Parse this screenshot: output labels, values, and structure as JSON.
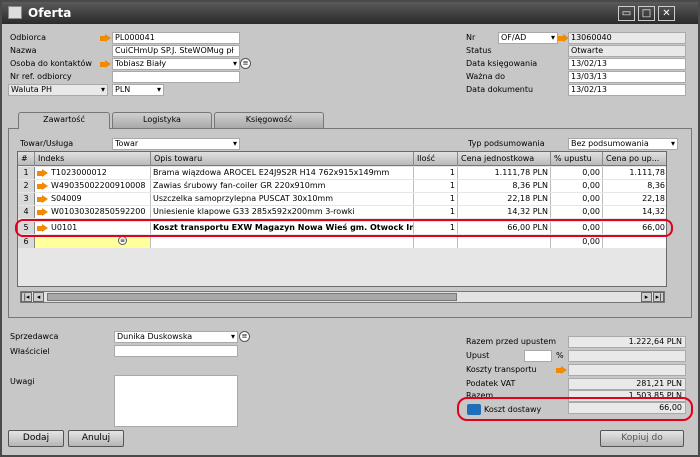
{
  "window": {
    "title": "Oferta",
    "buttons": [
      "▭",
      "□",
      "✕"
    ]
  },
  "header": {
    "odbiorca": {
      "label": "Odbiorca",
      "value": "PL000041"
    },
    "nazwa": {
      "label": "Nazwa",
      "value": "CuiCHmUp SP.J. SteWOMug pł"
    },
    "osoba": {
      "label": "Osoba do kontaktów",
      "value": "Tobiasz Biały"
    },
    "nr_ref": {
      "label": "Nr ref. odbiorcy",
      "value": ""
    },
    "waluta": {
      "label": "Waluta PH",
      "value": "PLN"
    },
    "nr": {
      "label": "Nr",
      "series": "OF/AD",
      "value": "13060040"
    },
    "status": {
      "label": "Status",
      "value": "Otwarte"
    },
    "data_ksiegowania": {
      "label": "Data księgowania",
      "value": "13/02/13"
    },
    "wazna_do": {
      "label": "Ważna do",
      "value": "13/03/13"
    },
    "data_dokumentu": {
      "label": "Data dokumentu",
      "value": "13/02/13"
    }
  },
  "tabs": [
    "Zawartość",
    "Logistyka",
    "Księgowość"
  ],
  "tab_content": {
    "towar_label": "Towar/Usługa",
    "towar_value": "Towar",
    "typ_label": "Typ podsumowania",
    "typ_value": "Bez podsumowania"
  },
  "table": {
    "columns": [
      "#",
      "Indeks",
      "Opis towaru",
      "Ilość",
      "Cena jednostkowa",
      "% upustu",
      "Cena po up..."
    ],
    "rows": [
      {
        "n": "1",
        "indeks": "T1023000012",
        "opis": "Brama wiązdowa AROCEL E24J9S2R H14 762x915x149mm",
        "ilosc": "1",
        "cena": "1.111,78 PLN",
        "upust": "0,00",
        "po": "1.111,78"
      },
      {
        "n": "2",
        "indeks": "W49035002200910008",
        "opis": "Zawias śrubowy fan-coiler GR 220x910mm",
        "ilosc": "1",
        "cena": "8,36 PLN",
        "upust": "0,00",
        "po": "8,36"
      },
      {
        "n": "3",
        "indeks": "S04009",
        "opis": "Uszczelka samoprzylepna PUSCAT 30x10mm",
        "ilosc": "1",
        "cena": "22,18 PLN",
        "upust": "0,00",
        "po": "22,18"
      },
      {
        "n": "4",
        "indeks": "W01030302850592200",
        "opis": "Uniesienie klapowe G33 285x592x200mm 3-rowki",
        "ilosc": "1",
        "cena": "14,32 PLN",
        "upust": "0,00",
        "po": "14,32"
      },
      {
        "n": "5",
        "indeks": "U0101",
        "opis": "Koszt transportu EXW Magazyn Nowa Wieś gm. Otwock Incoterms",
        "ilosc": "1",
        "cena": "66,00 PLN",
        "upust": "0,00",
        "po": "66,00"
      },
      {
        "n": "6",
        "indeks": "",
        "opis": "",
        "ilosc": "",
        "cena": "",
        "upust": "0,00",
        "po": ""
      }
    ]
  },
  "footer": {
    "sprzedawca": {
      "label": "Sprzedawca",
      "value": "Dunika Duskowska"
    },
    "wlasciciel": {
      "label": "Właściciel",
      "value": ""
    },
    "uwagi": {
      "label": "Uwagi",
      "value": ""
    },
    "totals": {
      "razem_przed": {
        "label": "Razem przed upustem",
        "value": "1.222,64 PLN"
      },
      "upust": {
        "label": "Upust",
        "value": "",
        "pct": "%"
      },
      "koszty": {
        "label": "Koszty transportu",
        "value": ""
      },
      "vat": {
        "label": "Podatek VAT",
        "value": "281,21 PLN"
      },
      "razem": {
        "label": "Razem",
        "value": "1.503,85 PLN"
      },
      "koszt_dostawy": {
        "label": "Koszt dostawy",
        "value": "66,00"
      }
    }
  },
  "buttons": {
    "dodaj": "Dodaj",
    "anuluj": "Anuluj",
    "kopiuj": "Kopiuj do"
  },
  "colors": {
    "highlight": "#e2001a",
    "arrow": "#f08a00",
    "selected": "#ffff9c"
  }
}
